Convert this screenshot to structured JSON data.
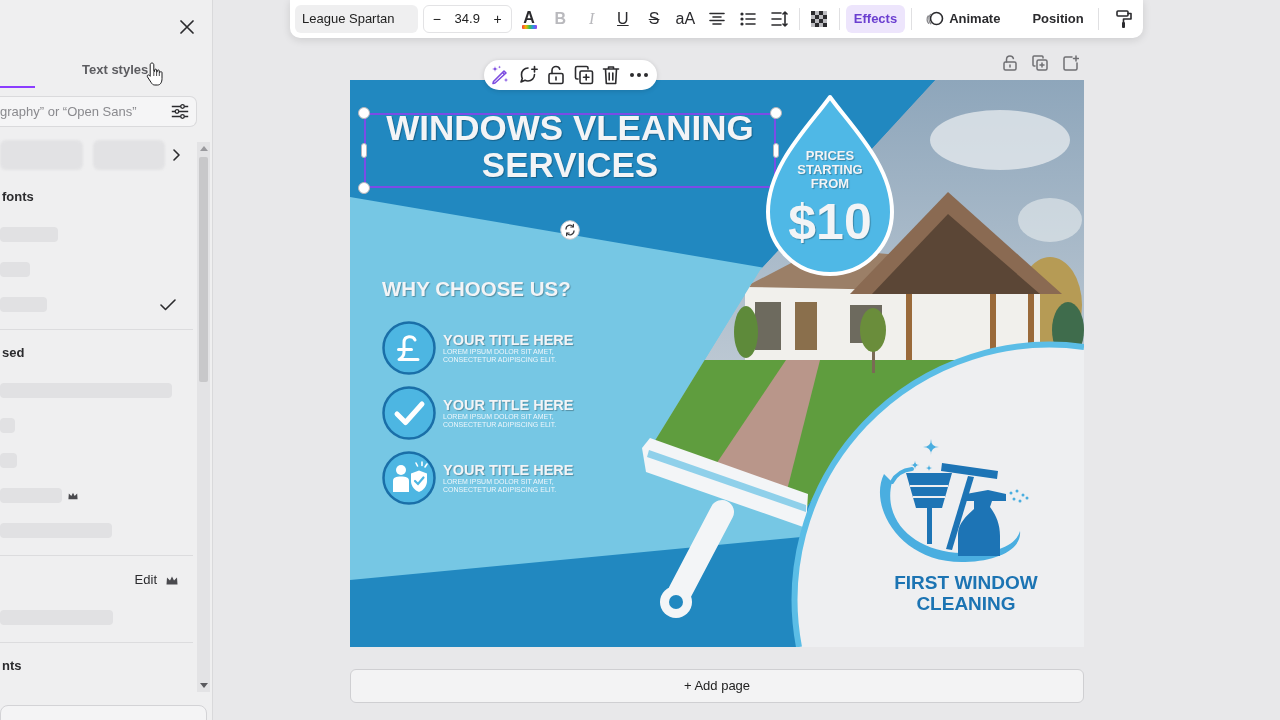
{
  "side_panel": {
    "tabs": [
      {
        "selected": true
      },
      {
        "label": "Text styles",
        "selected": false
      }
    ],
    "search": {
      "placeholder": "graphy” or “Open Sans”"
    },
    "sections": [
      {
        "heading": "fonts",
        "rows": [
          {
            "selected": false
          },
          {
            "selected": false
          },
          {
            "selected": true
          }
        ]
      },
      {
        "heading": "sed",
        "rows": [
          {
            "premium": false
          },
          {
            "premium": false
          },
          {
            "premium": false
          },
          {
            "premium": true
          },
          {
            "premium": false
          }
        ]
      },
      {
        "action": "Edit",
        "action_premium": true,
        "rows": [
          {
            "premium": false
          }
        ]
      },
      {
        "heading": "nts"
      }
    ]
  },
  "text_toolbar": {
    "font": "League Spartan",
    "size": "34.9",
    "size_controls": [
      "−",
      "+"
    ],
    "tools": [
      {
        "kind": "color",
        "label": "A",
        "disabled": false
      },
      {
        "kind": "bold",
        "label": "B",
        "disabled": true
      },
      {
        "kind": "italic",
        "label": "I",
        "disabled": true
      },
      {
        "kind": "underline",
        "label": "U",
        "disabled": false
      },
      {
        "kind": "strike",
        "label": "S",
        "disabled": false
      },
      {
        "kind": "case",
        "label": "aA",
        "disabled": false
      },
      {
        "kind": "align",
        "disabled": false
      },
      {
        "kind": "list",
        "disabled": false
      },
      {
        "kind": "spacing",
        "disabled": false
      },
      {
        "kind": "transparency",
        "disabled": false
      }
    ],
    "buttons": [
      {
        "kind": "effects",
        "label": "Effects",
        "selected": true
      },
      {
        "kind": "animate",
        "label": "Animate",
        "selected": false
      },
      {
        "kind": "position",
        "label": "Position",
        "selected": false
      }
    ]
  },
  "design": {
    "heading": {
      "text": "WINDOWS VLEANING SERVICES",
      "selected": true
    },
    "subheading": "WHY CHOOSE US?",
    "features": [
      {
        "kind": "pound",
        "title": "YOUR TITLE HERE",
        "text": "LOREM IPSUM DOLOR SIT AMET, CONSECTETUR ADIPISCING ELIT."
      },
      {
        "kind": "check",
        "title": "YOUR TITLE HERE",
        "text": "LOREM IPSUM DOLOR SIT AMET, CONSECTETUR ADIPISCING ELIT."
      },
      {
        "kind": "people",
        "title": "YOUR TITLE HERE",
        "text": "LOREM IPSUM DOLOR SIT AMET, CONSECTETUR ADIPISCING ELIT."
      }
    ],
    "price_badge": {
      "caption": "PRICES STARTING FROM",
      "price": "$10"
    },
    "logo_text": "FIRST WINDOW CLEANING"
  },
  "add_page": "+ Add page"
}
